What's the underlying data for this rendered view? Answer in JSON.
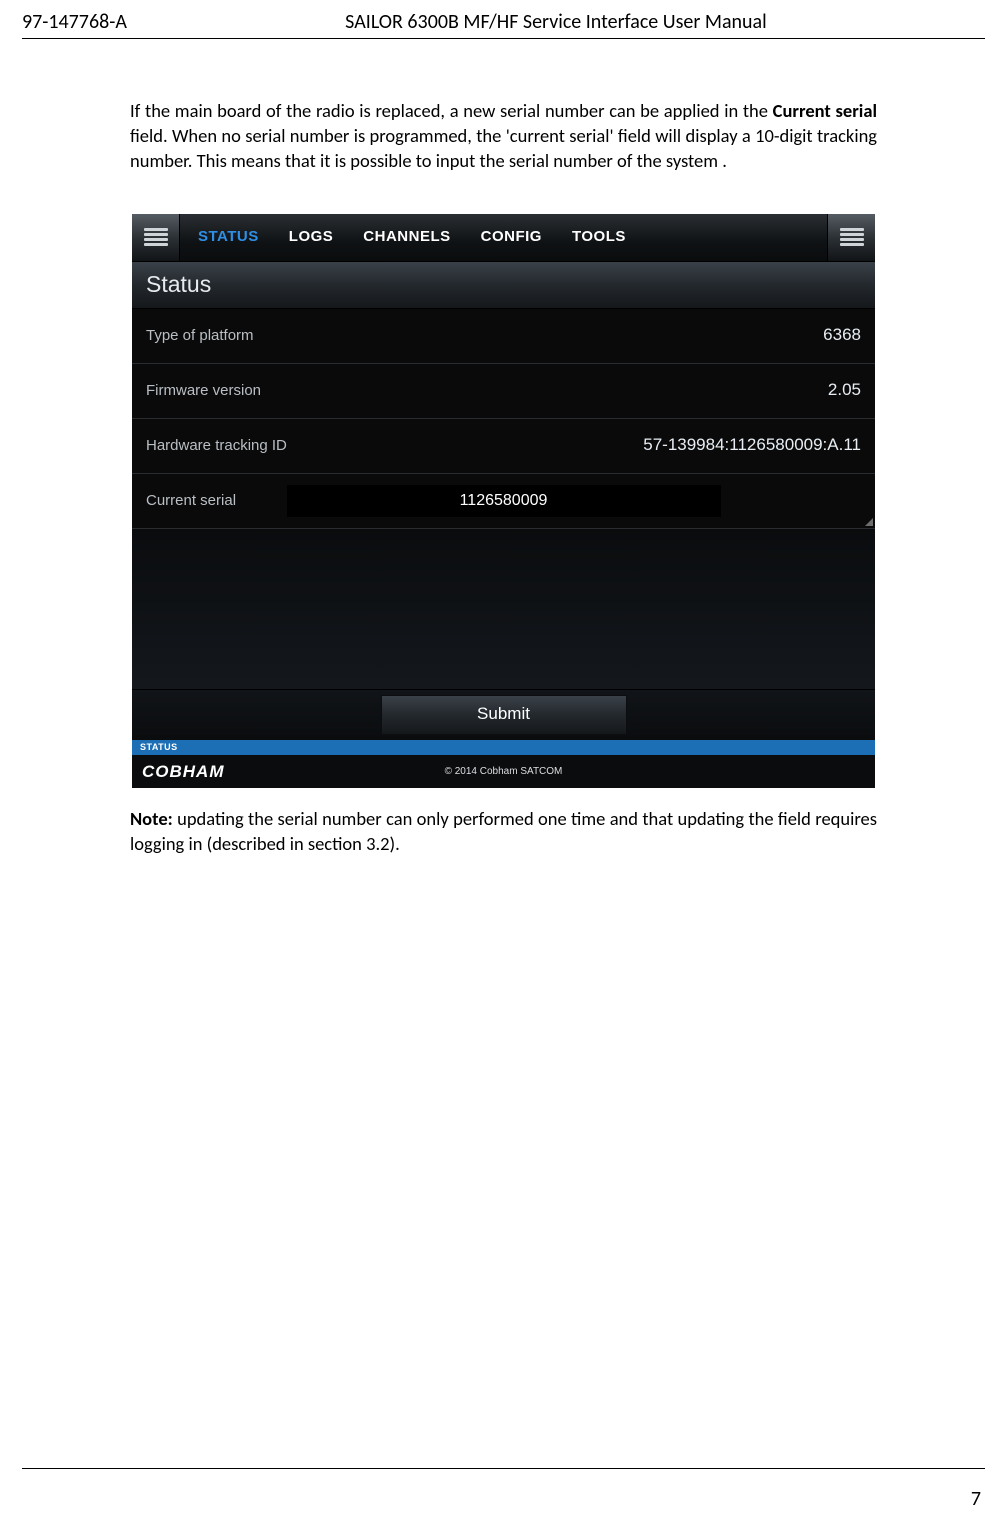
{
  "header": {
    "doc_id": "97-147768-A",
    "title": "SAILOR 6300B MF/HF Service Interface User Manual"
  },
  "paragraph1": "If the main board of the radio is replaced, a new serial number can be applied in the ",
  "paragraph1_bold": "Current serial",
  "paragraph1_rest": " field. When no serial number is programmed, the 'current serial' field will display a 10-digit tracking number. This means that it is possible to input the serial number of the system .",
  "ui": {
    "tabs": {
      "status": "STATUS",
      "logs": "LOGS",
      "channels": "CHANNELS",
      "config": "CONFIG",
      "tools": "TOOLS"
    },
    "section_title": "Status",
    "rows": {
      "platform_label": "Type of platform",
      "platform_value": "6368",
      "firmware_label": "Firmware version",
      "firmware_value": "2.05",
      "tracking_label": "Hardware tracking ID",
      "tracking_value": "57-139984:1126580009:A.11",
      "serial_label": "Current serial",
      "serial_value": "1126580009"
    },
    "submit_label": "Submit",
    "footer_status": "STATUS",
    "logo_text": "COBHAM",
    "copyright": "© 2014 Cobham SATCOM"
  },
  "note_bold": "Note:",
  "note_rest": " updating the serial number can only performed one time and that updating the field requires logging in (described in section 3.2).",
  "page_number": "7"
}
